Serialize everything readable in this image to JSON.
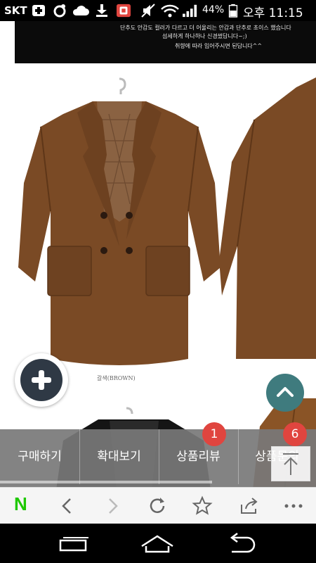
{
  "status_bar": {
    "carrier": "SKT",
    "battery_percent": "44%",
    "time": "오후 11:15",
    "icons": [
      "add-icon",
      "location-icon",
      "cloud-icon",
      "download-icon",
      "app-notification-icon",
      "mute-icon",
      "wifi-icon",
      "signal-icon",
      "battery-icon"
    ]
  },
  "notice": {
    "line1": "단추도 안감도 컬러가 다르고 더 어울리는 안감과 단추로 초이스 했습니다",
    "line2": "섬세하게 하나하나 신경썼답니다~;)",
    "line3": "취향에 따라 입어주시면 된답니다^^"
  },
  "product": {
    "color_caption": "갈색(BROWN)",
    "coat_color": "#7a4a25"
  },
  "tabs": {
    "buy": "구매하기",
    "zoom": "확대보기",
    "review": "상품리뷰",
    "qna": "상품문의",
    "review_count": "1",
    "qna_count": "6"
  },
  "browser_bar": {
    "items": [
      "naver-logo-icon",
      "back-icon",
      "forward-icon",
      "refresh-icon",
      "bookmark-star-icon",
      "share-icon",
      "more-icon"
    ],
    "logo_text": "N"
  },
  "nav_bar": {
    "items": [
      "recent-apps-icon",
      "home-icon",
      "back-nav-icon"
    ]
  },
  "colors": {
    "fab_dark": "#2f3945",
    "fab_teal": "#3f7b7e",
    "badge_red": "#e0453f",
    "naver_green": "#1ec800"
  }
}
